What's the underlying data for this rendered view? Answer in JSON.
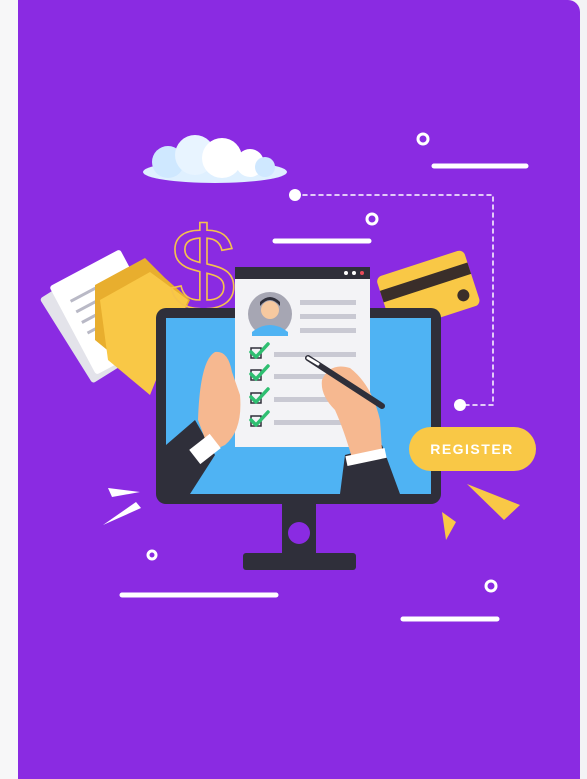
{
  "illustration": {
    "register_label": "REGISTER",
    "currency_symbol": "$",
    "icons": [
      "cloud-icon",
      "dollar-sign-icon",
      "documents-icon",
      "folder-icon",
      "credit-card-icon",
      "monitor-icon",
      "resume-icon",
      "avatar-icon",
      "checkmark-icon",
      "pen-icon",
      "hand-icon"
    ],
    "colors": {
      "background": "#8a2be2",
      "accent_yellow": "#f9c846",
      "screen_blue": "#4fb3f3",
      "monitor_dark": "#2f2f3a",
      "check_green": "#2fbf71"
    }
  }
}
